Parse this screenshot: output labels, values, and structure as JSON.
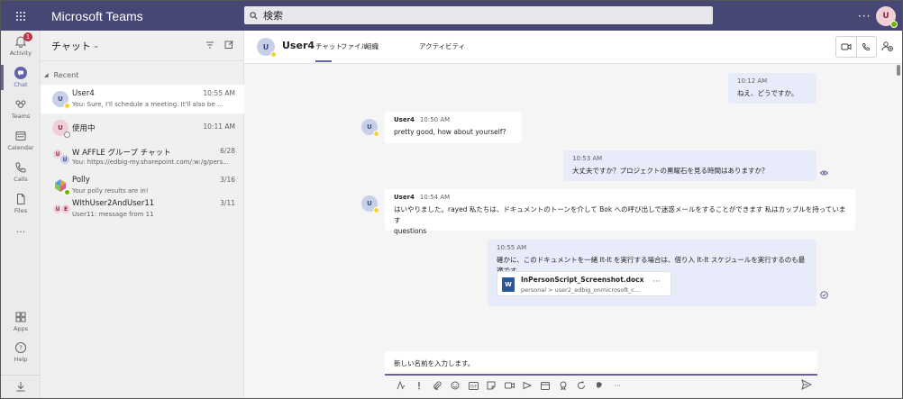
{
  "titlebar": {
    "app_name": "Microsoft Teams",
    "search_placeholder": "検索",
    "more": "···",
    "me_initials": "U"
  },
  "rail": {
    "items": [
      {
        "label": "Activity",
        "badge": "1"
      },
      {
        "label": "Chat"
      },
      {
        "label": "Teams"
      },
      {
        "label": "Calendar"
      },
      {
        "label": "Calls"
      },
      {
        "label": "Files"
      },
      {
        "label": "···"
      },
      {
        "label": "Apps"
      },
      {
        "label": "Help"
      }
    ]
  },
  "chatlist": {
    "title": "チャット",
    "section": "Recent",
    "rows": [
      {
        "name": "User4",
        "time": "10:55 AM",
        "preview": "You: Sure, I'll schedule a meeting. It'll also be ...",
        "initials": "U"
      },
      {
        "name": "使用中",
        "time": "10:11 AM",
        "preview": "",
        "initials": "U"
      },
      {
        "name": "W AFFLE グループ チャット",
        "time": "6/28",
        "preview": "You: https://edbig-my.sharepoint.com/:w:/g/pers...",
        "initials_a": "U",
        "initials_b": "U"
      },
      {
        "name": "Polly",
        "time": "3/16",
        "preview": "Your polly results are in!"
      },
      {
        "name": "WIthUser2AndUser11",
        "time": "3/11",
        "preview": "User11: message from 11",
        "initials_a": "U",
        "initials_b": "E"
      }
    ]
  },
  "conversation": {
    "title": "User4",
    "initials": "U",
    "tabs": [
      "チャット",
      "ファイル",
      "組織",
      "アクティビティ"
    ],
    "messages": [
      {
        "time": "10:12 AM",
        "text": "ねえ、どうですか。"
      },
      {
        "author": "User4",
        "time": "10:50 AM",
        "text": "pretty good, how about yourself?"
      },
      {
        "time": "10:53 AM",
        "text": "大丈夫ですか？プロジェクトの黒曜石を見る時間はありますか？"
      },
      {
        "author": "User4",
        "time": "10:54 AM",
        "text": "はいやりました。rayed 私たちは、ドキュメントのトーンを介して Bok への呼び出しで迷惑メールをすることができます 私はカップルを持っています",
        "text2": "questions"
      },
      {
        "time": "10:55 AM",
        "text": "確かに、このドキュメントを一緒 It-It を実行する場合は、借り入 It-It スケジュールを実行するのも最適です"
      }
    ],
    "file": {
      "name": "InPersonScript_Screenshot.docx",
      "path": "personal > user2_edbig_onmicrosoft_c...",
      "icon_letter": "W",
      "more": "···"
    },
    "compose_text": "新しい名前を入力します。",
    "toolbar_more": "···"
  }
}
